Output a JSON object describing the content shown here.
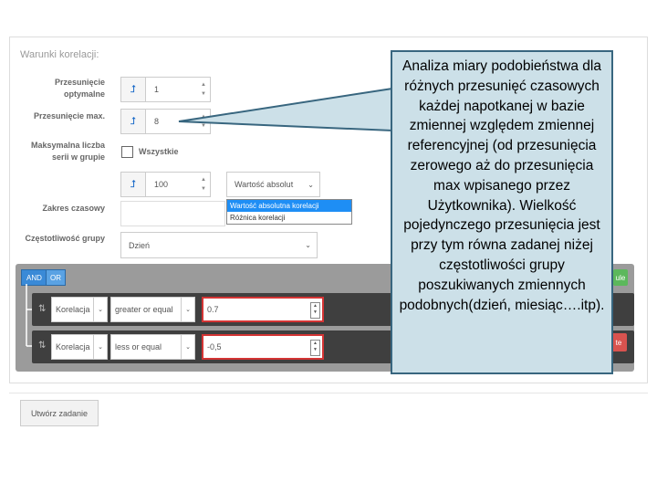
{
  "panel": {
    "title": "Warunki korelacji:"
  },
  "fields": {
    "optimal_shifts_label_1": "Przesunięcie",
    "optimal_shifts_label_2": "optymalne",
    "optimal_shifts_value": "1",
    "max_shift_label": "Przesunięcie max.",
    "max_shift_value": "8",
    "max_series_label_1": "Maksymalna liczba",
    "max_series_label_2": "serii w grupie",
    "all_label": "Wszystkie",
    "series_count_value": "100",
    "value_type_selected": "Wartość absolut",
    "value_type_options": [
      "Wartość absolutna korelacji",
      "Różnica korelacji"
    ],
    "time_range_label": "Zakres czasowy",
    "frequency_label": "Częstotliwość grupy",
    "frequency_value": "Dzień"
  },
  "rules": {
    "and_label": "AND",
    "or_label": "OR",
    "add_rule_partial": "ule",
    "delete_partial": "te",
    "rows": [
      {
        "field": "Korelacja",
        "operator": "greater or equal",
        "value": "0.7"
      },
      {
        "field": "Korelacja",
        "operator": "less or equal",
        "value": "-0,5"
      }
    ]
  },
  "footer": {
    "create_label": "Utwórz zadanie"
  },
  "callout": {
    "text": "Analiza miary podobieństwa dla różnych przesunięć czasowych każdej napotkanej w bazie zmiennej względem zmiennej referencyjnej (od przesunięcia zerowego aż do przesunięcia max wpisanego przez Użytkownika). Wielkość pojedynczego przesunięcia jest przy tym równa zadanej niżej częstotliwości grupy poszukiwanych zmiennych podobnych(dzień, miesiąc….itp)."
  },
  "icons": {
    "swap": "⇅",
    "up_down": "▲▼",
    "caret": "⌄"
  },
  "colors": {
    "and_button": "#3a8ad7",
    "or_button": "#3a8ad7",
    "add_rule": "#5cb85c",
    "delete": "#d9534f",
    "invalid_border": "#d43434",
    "callout_bg": "#cce0e8",
    "callout_border": "#38667f"
  }
}
